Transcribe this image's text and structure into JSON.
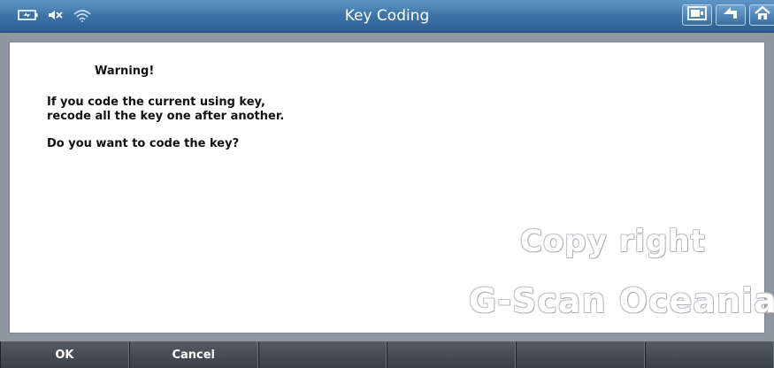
{
  "window": {
    "title": "Key Coding"
  },
  "status_icons": [
    "battery-icon",
    "speaker-muted-icon",
    "wifi-icon"
  ],
  "top_buttons": [
    "screen-capture-icon",
    "back-arrow-icon",
    "home-icon"
  ],
  "message": {
    "heading": "Warning!",
    "line1": "If you code the current using key,",
    "line2": "recode all the key one after another.",
    "line3": "Do you want to code the key?"
  },
  "watermark": {
    "line1": "Copy right",
    "line2": "G-Scan Oceania"
  },
  "function_keys": {
    "f1": "OK",
    "f2": "Cancel",
    "f3": "",
    "f4": "",
    "f5": "",
    "f6": ""
  },
  "colors": {
    "title_bar": "#3c73a6",
    "function_bar": "#3d4349",
    "panel": "#ffffff"
  }
}
